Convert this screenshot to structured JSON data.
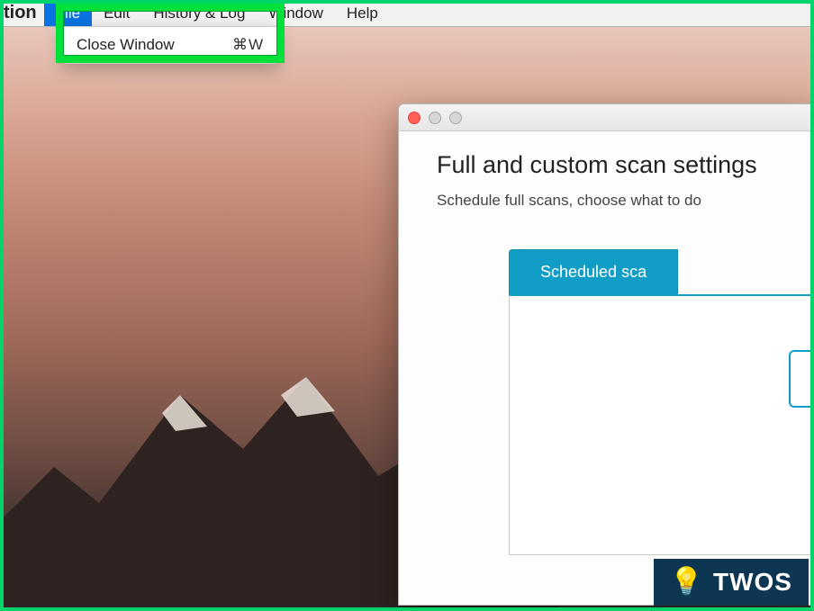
{
  "menubar": {
    "app_suffix": "tion",
    "items": [
      {
        "label": "File",
        "selected": true
      },
      {
        "label": "Edit",
        "selected": false
      },
      {
        "label": "History & Log",
        "selected": false
      },
      {
        "label": "Window",
        "selected": false
      },
      {
        "label": "Help",
        "selected": false
      }
    ]
  },
  "file_menu": {
    "items": [
      {
        "label": "Close Window",
        "shortcut": "⌘W"
      }
    ]
  },
  "panel": {
    "title": "Full and custom scan settings",
    "description": "Schedule full scans, choose what to do",
    "tab_label": "Scheduled sca",
    "traffic_lights": {
      "close": "close",
      "minimize": "minimize",
      "zoom": "zoom"
    }
  },
  "watermark": {
    "text": "TWOS",
    "icon": "lightbulb-icon"
  }
}
